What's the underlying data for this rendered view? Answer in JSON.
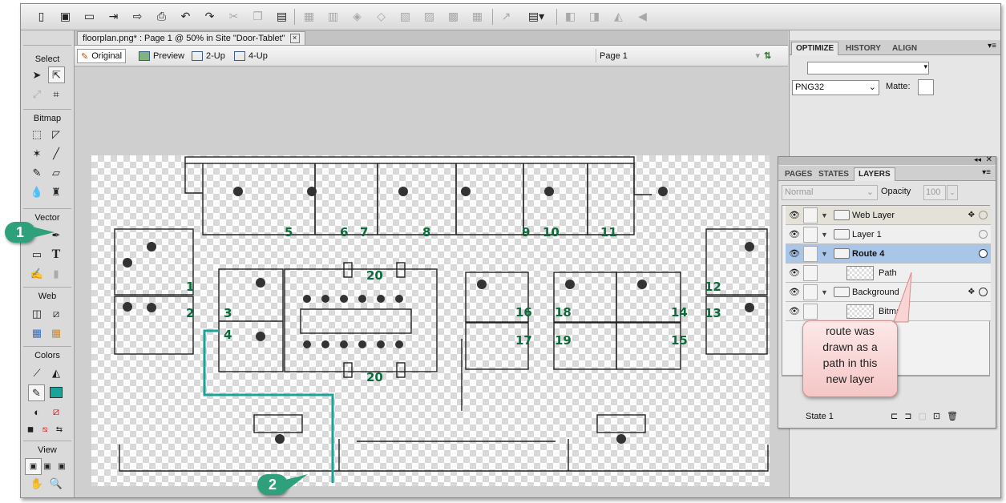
{
  "document_tab": {
    "title": "floorplan.png* : Page 1 @  50% in Site \"Door-Tablet\"",
    "close": "×"
  },
  "view_buttons": {
    "original": "Original",
    "preview": "Preview",
    "two_up": "2-Up",
    "four_up": "4-Up",
    "page": "Page 1"
  },
  "tools": {
    "select": "Select",
    "bitmap": "Bitmap",
    "vector": "Vector",
    "web": "Web",
    "colors": "Colors",
    "view": "View",
    "text_tool": "T"
  },
  "panel_top": {
    "tabs": [
      "OPTIMIZE",
      "HISTORY",
      "ALIGN"
    ],
    "format": "PNG32",
    "matte_label": "Matte:"
  },
  "layers_panel": {
    "tabs": [
      "PAGES",
      "STATES",
      "LAYERS"
    ],
    "blend_mode": "Normal",
    "opacity_label": "Opacity",
    "opacity_value": "100",
    "rows": [
      {
        "name": "Web Layer"
      },
      {
        "name": "Layer 1"
      },
      {
        "name": "Route 4"
      },
      {
        "name": "Path"
      },
      {
        "name": "Background"
      },
      {
        "name": "Bitmap"
      }
    ],
    "state": "State 1"
  },
  "callout": {
    "lines": [
      "route was",
      "drawn as a",
      "path in this",
      "new layer"
    ]
  },
  "badges": {
    "one": "1",
    "two": "2"
  },
  "room_numbers": [
    "5",
    "6",
    "7",
    "8",
    "9",
    "10",
    "11",
    "1",
    "2",
    "3",
    "4",
    "20",
    "20",
    "16",
    "17",
    "18",
    "19",
    "14",
    "15",
    "12",
    "13"
  ],
  "colors": {
    "route": "#1aa39a",
    "room_number": "#0b6b3a",
    "badge": "#2fa07c",
    "selected_layer": "#a9c5e8",
    "stroke_swatch": "#1aa39a"
  }
}
